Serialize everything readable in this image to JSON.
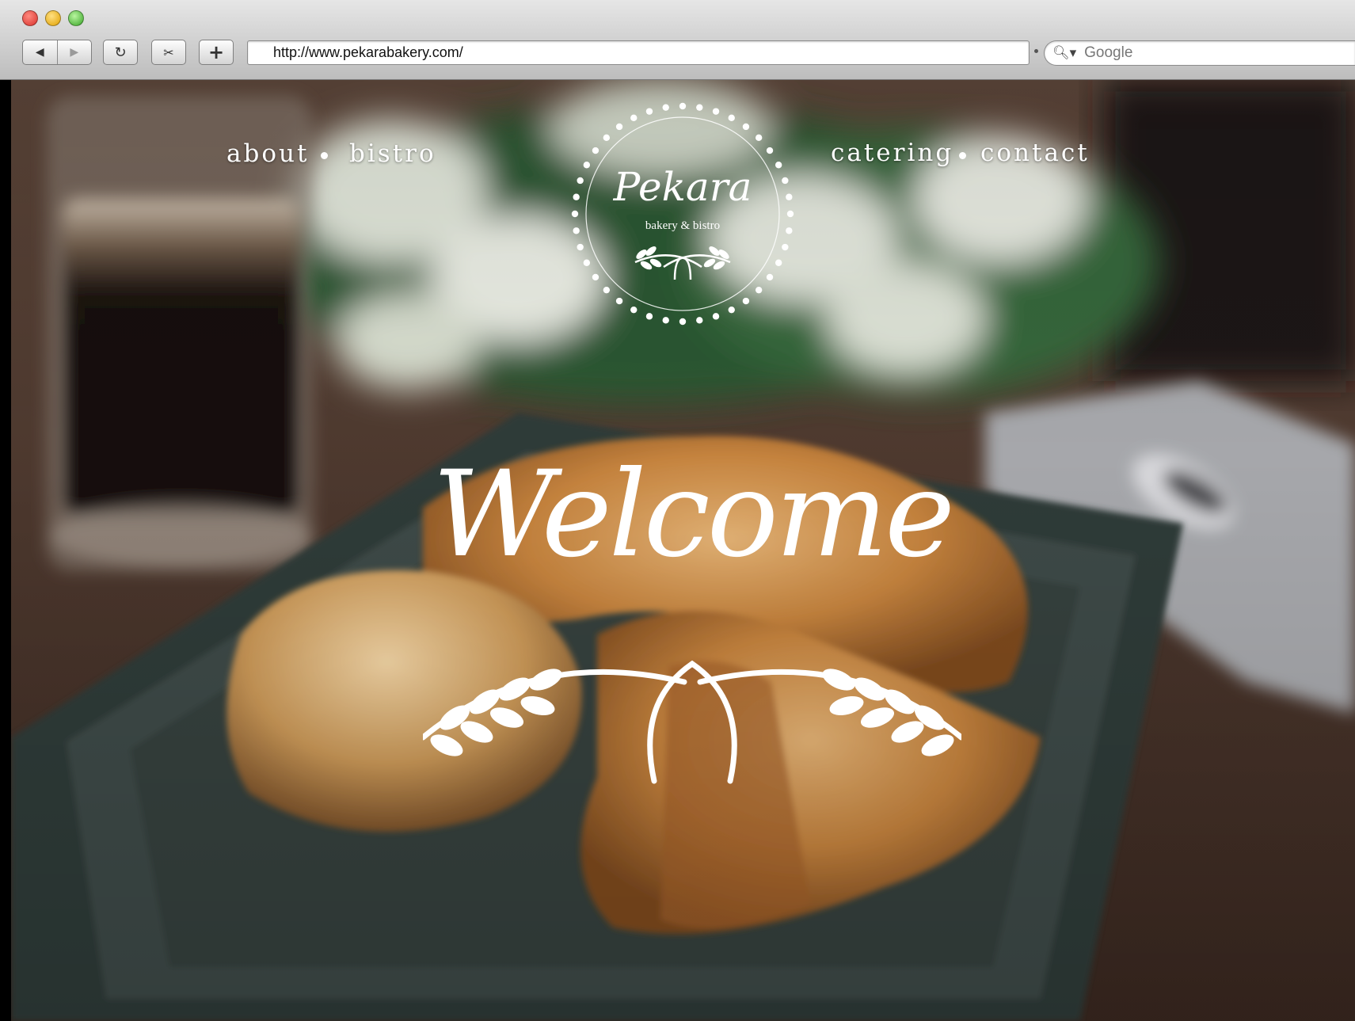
{
  "browser": {
    "back_icon": "back-arrow-icon",
    "forward_icon": "forward-arrow-icon",
    "reload_icon": "reload-icon",
    "snip_icon": "scissors-icon",
    "add_tab_icon": "plus-icon",
    "url": "http://www.pekarabakery.com/",
    "search_icon": "magnifier-icon",
    "search_placeholder": "Google"
  },
  "site": {
    "nav_left": [
      "about",
      "bistro"
    ],
    "nav_right": [
      "catering",
      "contact"
    ],
    "logo": {
      "name": "Pekara",
      "tagline": "bakery & bistro"
    },
    "hero_heading": "Welcome"
  },
  "colors": {
    "text": "#ffffff",
    "plate": "#36433f",
    "pastry": "#c98a45",
    "greenery": "#2f5a34",
    "table": "#4a352b"
  }
}
